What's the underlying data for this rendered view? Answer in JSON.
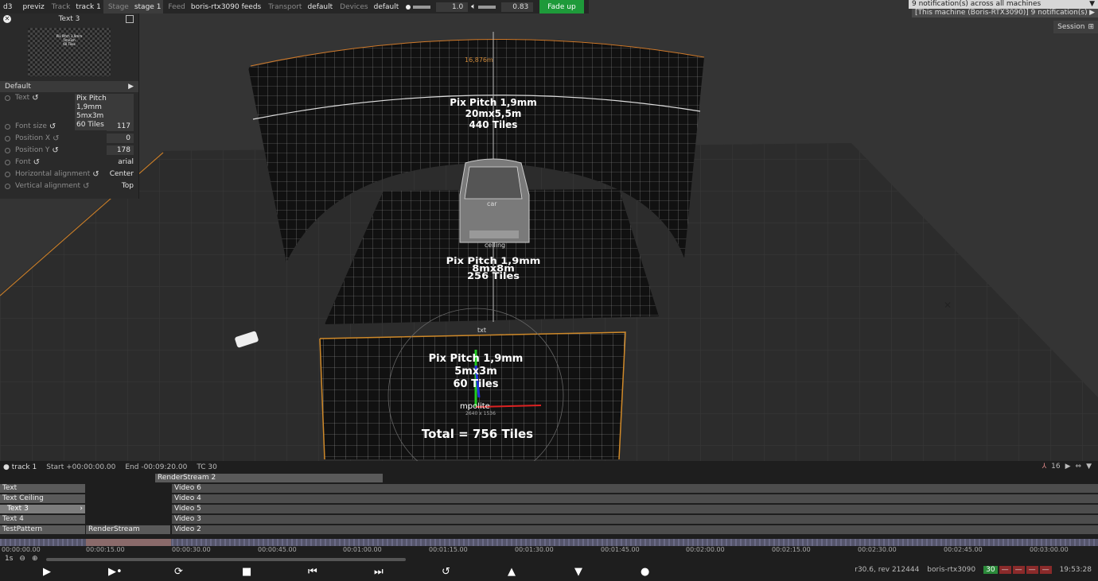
{
  "topbar": {
    "app": "d3",
    "mode": "previz",
    "track_label": "Track",
    "track_value": "track 1",
    "stage_label": "Stage",
    "stage_value": "stage 1",
    "feed_label": "Feed",
    "feed_value": "boris-rtx3090 feeds",
    "transport_label": "Transport",
    "transport_value": "default",
    "devices_label": "Devices",
    "devices_value": "default",
    "brightness": "1.0",
    "volume": "0.83",
    "fadeup": "Fade up"
  },
  "notifications": {
    "all": "9 notification(s) across all machines",
    "this": "[This machine (Boris-RTX3090)] 9 notification(s)",
    "session": "Session"
  },
  "panel": {
    "title": "Text 3",
    "preview_lines": [
      "Pix Pitch 1,9mm",
      "5mx3m",
      "60 Tiles"
    ],
    "section": "Default",
    "props": {
      "text_label": "Text",
      "text_lines": [
        "Pix Pitch 1,9mm",
        "5mx3m",
        "60 Tiles"
      ],
      "fontsize_label": "Font size",
      "fontsize_value": "117",
      "posx_label": "Position X",
      "posx_value": "0",
      "posy_label": "Position Y",
      "posy_value": "178",
      "font_label": "Font",
      "font_value": "arial",
      "halign_label": "Horizontal alignment",
      "halign_value": "Center",
      "valign_label": "Vertical alignment",
      "valign_value": "Top"
    }
  },
  "viewport": {
    "wall_width": "16,876m",
    "wall_lines": [
      "Pix Pitch 1,9mm",
      "20mx5,5m",
      "440 Tiles"
    ],
    "car_label": "car",
    "ceiling_label": "ceiling",
    "floor_lines": [
      "Pix Pitch 1,9mm",
      "8mx8m",
      "256 Tiles"
    ],
    "txt_label": "txt",
    "front_lines": [
      "Pix Pitch 1,9mm",
      "5mx3m",
      "60 Tiles"
    ],
    "mpolite": "mpolite",
    "mpolite_sub": "2640 x 1536",
    "total": "Total = 756 Tiles"
  },
  "timeline": {
    "track": "track 1",
    "start": "Start +00:00:00.00",
    "end": "End -00:09:20.00",
    "tc": "TC 30",
    "zoom_num": "16",
    "layers_left": [
      "Text",
      "Text Ceiling",
      "Text 3",
      "Text 4",
      "TestPattern"
    ],
    "renderstream": "RenderStream",
    "renderstream2": "RenderStream 2",
    "videos": [
      "Video 6",
      "Video 4",
      "Video 5",
      "Video 3",
      "Video 2"
    ],
    "ticks": [
      "00:00:00.00",
      "00:00:15.00",
      "00:00:30.00",
      "00:00:45.00",
      "00:01:00.00",
      "00:01:15.00",
      "00:01:30.00",
      "00:01:45.00",
      "00:02:00.00",
      "00:02:15.00",
      "00:02:30.00",
      "00:02:45.00",
      "00:03:00.00"
    ],
    "step": "1s",
    "version": "r30.6, rev 212444",
    "machine": "boris-rtx3090",
    "fps": "30",
    "clock": "19:53:28"
  }
}
